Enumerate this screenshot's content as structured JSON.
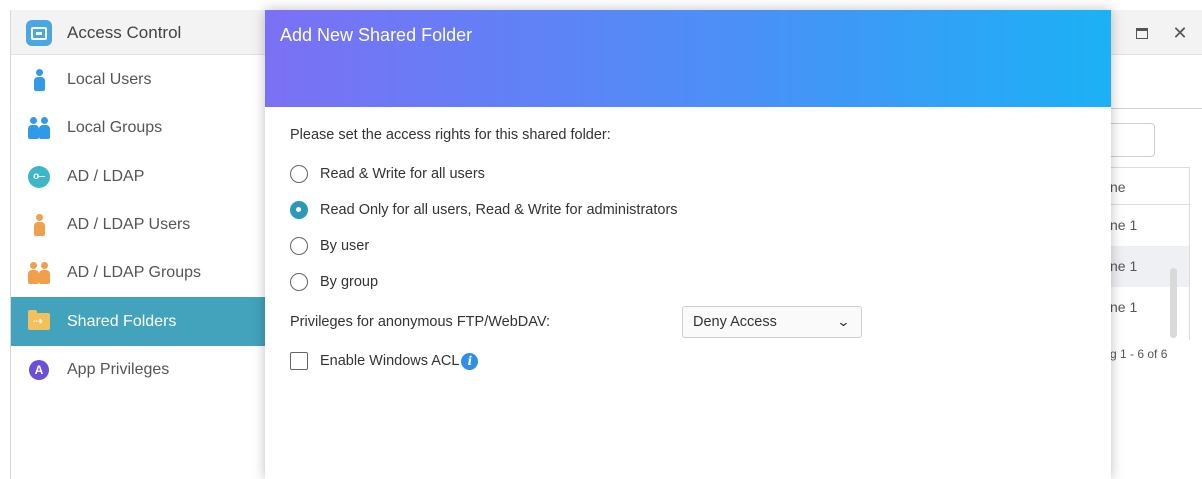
{
  "app": {
    "title": "Access Control",
    "icon": "access-control-icon"
  },
  "sidebar": {
    "items": [
      {
        "label": "Local Users",
        "icon": "user-icon"
      },
      {
        "label": "Local Groups",
        "icon": "group-icon"
      },
      {
        "label": "AD / LDAP",
        "icon": "key-icon"
      },
      {
        "label": "AD / LDAP Users",
        "icon": "user-icon"
      },
      {
        "label": "AD / LDAP Groups",
        "icon": "group-icon"
      },
      {
        "label": "Shared Folders",
        "icon": "shared-folder-icon",
        "active": true
      },
      {
        "label": "App Privileges",
        "icon": "app-privileges-icon"
      }
    ]
  },
  "background": {
    "column_header": "ne",
    "rows": [
      "ne 1",
      "ne 1",
      "ne 1"
    ],
    "pager": "g 1 - 6 of 6"
  },
  "dialog": {
    "title": "Add New Shared Folder",
    "prompt": "Please set the access rights for this shared folder:",
    "options": [
      {
        "label": "Read & Write for all users",
        "checked": false
      },
      {
        "label": "Read Only for all users, Read & Write for administrators",
        "checked": true
      },
      {
        "label": "By user",
        "checked": false
      },
      {
        "label": "By group",
        "checked": false
      }
    ],
    "anonymous_label": "Privileges for anonymous FTP/WebDAV:",
    "anonymous_value": "Deny Access",
    "acl_label": "Enable Windows ACL",
    "acl_checked": false
  },
  "colors": {
    "accent": "#43a3bd",
    "radio_checked": "#2a9ab8",
    "header_gradient_start": "#7b70f4",
    "header_gradient_end": "#1bb1f5"
  }
}
